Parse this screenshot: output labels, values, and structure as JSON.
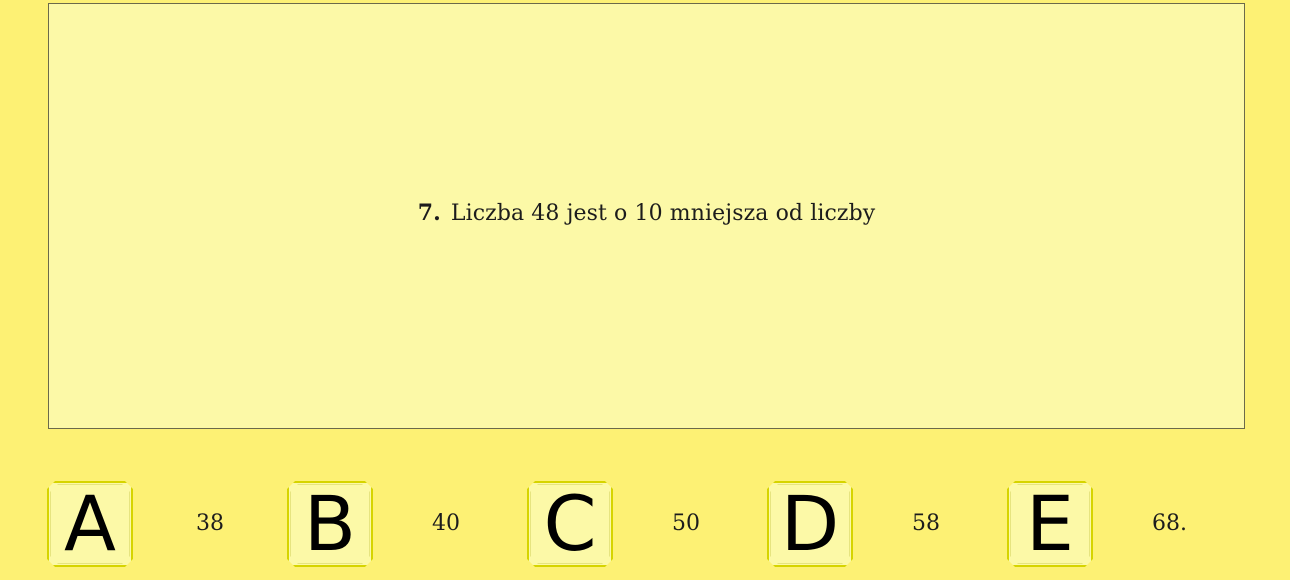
{
  "question": {
    "number": "7.",
    "text": "Liczba 48 jest o 10 mniejsza od liczby"
  },
  "answers": [
    {
      "letter": "A",
      "value": "38"
    },
    {
      "letter": "B",
      "value": "40"
    },
    {
      "letter": "C",
      "value": "50"
    },
    {
      "letter": "D",
      "value": "58"
    },
    {
      "letter": "E",
      "value": "68."
    }
  ],
  "colors": {
    "background": "#fdf174",
    "panel": "#fcf9a7",
    "key_border": "#d6d400"
  }
}
